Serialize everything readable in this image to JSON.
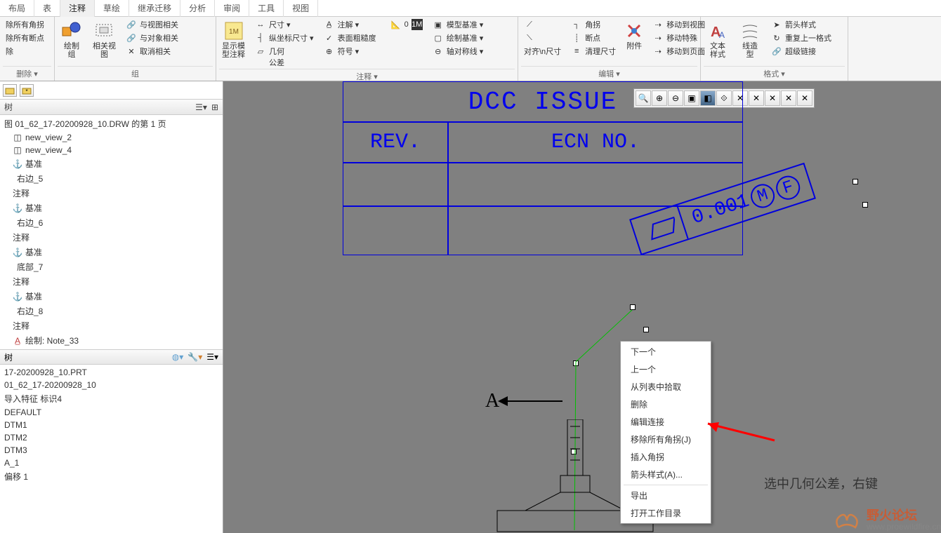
{
  "tabs": [
    "布局",
    "表",
    "注释",
    "草绘",
    "继承迁移",
    "分析",
    "审阅",
    "工具",
    "视图"
  ],
  "active_tab": 2,
  "ribbon": {
    "delete_group": {
      "items": [
        "除所有角拐",
        "除所有断点",
        "除"
      ],
      "label": "删除 ▾"
    },
    "group_group": {
      "draw_group_btn": "绘制\n组",
      "related_view": "相关视\n图",
      "items": [
        "与视图相关",
        "与对象相关",
        "取消相关"
      ],
      "label": "组"
    },
    "annotate_group": {
      "show_model_btn": "显示模\n型注释",
      "col1": [
        "尺寸 ▾",
        "纵坐标尺寸 ▾",
        "几何\n公差"
      ],
      "annot": "注解 ▾",
      "surface": "表面粗糙度",
      "symbol": "符号 ▾",
      "right_col": [
        "模型基准 ▾",
        "绘制基准 ▾",
        "轴对称线 ▾"
      ],
      "label": "注释 ▾"
    },
    "edit_group": {
      "col1": [
        "角拐",
        "断点",
        "清理尺寸"
      ],
      "attach_btn": "附件",
      "col2": [
        "移动到视图",
        "移动特殊",
        "移动到页面"
      ],
      "label": "编辑 ▾"
    },
    "format_group": {
      "text_style": "文本\n样式",
      "line_style": "线造\n型",
      "col": [
        "箭头样式",
        "重复上一格式",
        "超级链接"
      ],
      "label": "格式 ▾"
    }
  },
  "drawing_tree": {
    "header": "树",
    "root": "图 01_62_17-20200928_10.DRW 的第 1 页",
    "items": [
      "new_view_2",
      "new_view_4",
      "基准",
      "右边_5",
      "注释",
      "基准",
      "右边_6",
      "注释",
      "基准",
      "底部_7",
      "注释",
      "基准",
      "右边_8",
      "注释",
      "",
      "绘制: Note_33"
    ]
  },
  "model_tree": {
    "header": "树",
    "items": [
      "17-20200928_10.PRT",
      "01_62_17-20200928_10",
      "导入特征 标识4",
      "DEFAULT",
      "DTM1",
      "DTM2",
      "DTM3",
      "A_1",
      "偏移 1"
    ]
  },
  "drawing": {
    "dcc": "DCC ISSUE",
    "rev": "REV.",
    "ecn": "ECN NO.",
    "gtol_value": "0.001",
    "gtol_mod1": "M",
    "gtol_mod2": "F",
    "datum": "A"
  },
  "context_menu": {
    "items": [
      "下一个",
      "上一个",
      "从列表中拾取",
      "删除",
      "编辑连接",
      "移除所有角拐(J)",
      "插入角拐",
      "箭头样式(A)...",
      "",
      "导出",
      "打开工作目录"
    ]
  },
  "hint": "选中几何公差，右键",
  "watermark": {
    "title": "野火论坛",
    "url": "www.proewildfire.cn"
  }
}
